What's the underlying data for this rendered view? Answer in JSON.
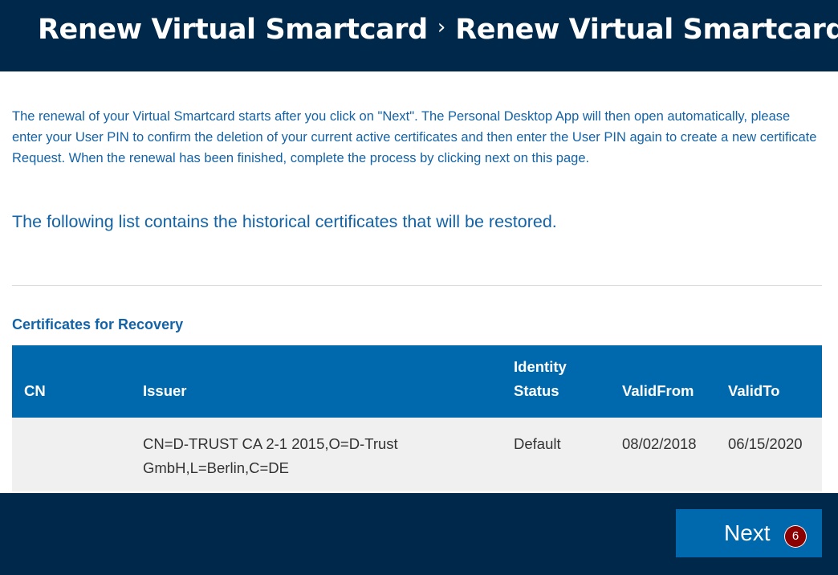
{
  "header": {
    "breadcrumb": [
      {
        "label": "Renew Virtual Smartcard"
      },
      {
        "label": "Renew Virtual Smartcard"
      }
    ],
    "separator": "›"
  },
  "main": {
    "intro_text": "The renewal of your Virtual Smartcard starts after you click on \"Next\". The Personal Desktop App will then open automatically, please enter your User PIN to confirm the deletion of your current active certificates and then enter the User PIN again to create a new certificate Request. When the renewal has been finished, complete the process by clicking next on this page.",
    "list_heading": "The following list contains the historical certificates that will be restored.",
    "section_title": "Certificates for Recovery",
    "table": {
      "columns": [
        "CN",
        "Issuer",
        "Identity Status",
        "ValidFrom",
        "ValidTo"
      ],
      "rows": [
        {
          "cn": "",
          "issuer": "CN=D-TRUST CA 2-1 2015,O=D-Trust GmbH,L=Berlin,C=DE",
          "status": "Default",
          "valid_from": "08/02/2018",
          "valid_to": "06/15/2020"
        }
      ]
    }
  },
  "footer": {
    "next_label": "Next",
    "next_badge": "6"
  },
  "colors": {
    "header_bg": "#00284a",
    "accent": "#0069ad",
    "text_blue": "#1463a6",
    "badge": "#8b0000",
    "row_bg": "#f0f0f0"
  }
}
